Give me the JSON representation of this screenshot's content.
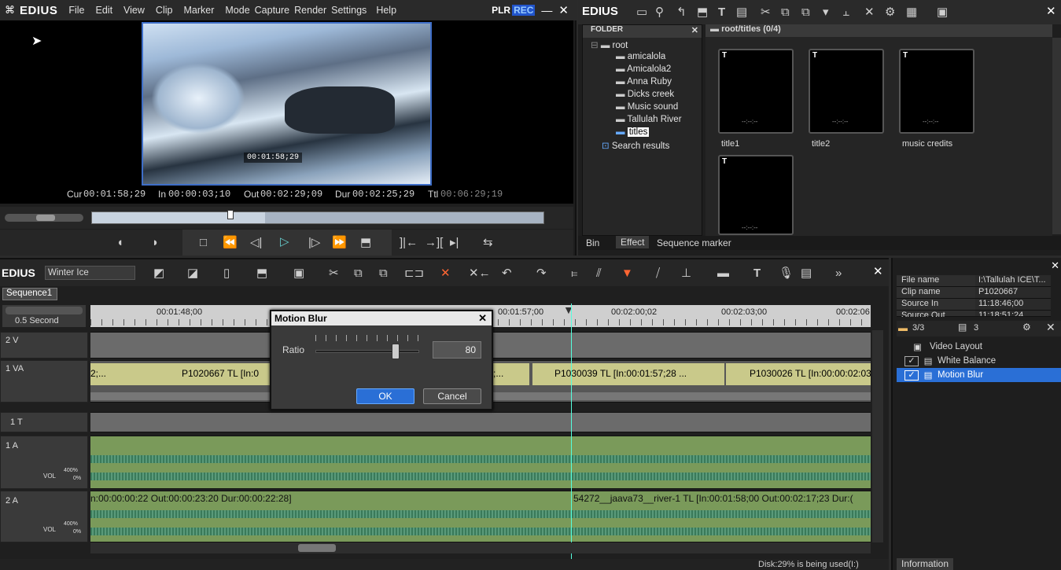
{
  "player": {
    "logo": "EDIUS",
    "menu": [
      "File",
      "Edit",
      "View",
      "Clip",
      "Marker",
      "Mode",
      "Capture",
      "Render",
      "Settings",
      "Help"
    ],
    "mode_plr": "PLR",
    "mode_rec": "REC",
    "overlay_tc": "00:01:58;29",
    "cur_label": "Cur",
    "cur": "00:01:58;29",
    "in_label": "In",
    "in": "00:00:03;10",
    "out_label": "Out",
    "out": "00:02:29;09",
    "dur_label": "Dur",
    "dur": "00:02:25;29",
    "ttl_label": "Ttl",
    "ttl": "00:06:29;19"
  },
  "bin": {
    "logo": "EDIUS",
    "folder_header": "FOLDER",
    "path": "root/titles (0/4)",
    "tree": [
      "root",
      "amicalola",
      "Amicalola2",
      "Anna Ruby",
      "Dicks creek",
      "Music sound",
      "Tallulah River",
      "titles",
      "Search results"
    ],
    "thumbs": [
      {
        "name": "title1"
      },
      {
        "name": "title2"
      },
      {
        "name": "music credits"
      },
      {
        "name": ""
      }
    ],
    "tabs": [
      "Bin",
      "Effect",
      "Sequence marker"
    ]
  },
  "timeline": {
    "logo": "EDIUS",
    "project": "Winter Ice",
    "sequence_tab": "Sequence1",
    "scale": "0.5 Second",
    "ruler": [
      "00:01:48;00",
      "00:01:57;00",
      "00:02:00;02",
      "00:02:03;00",
      "00:02:06"
    ],
    "tracks": {
      "v2": "2 V",
      "va1": "1 VA",
      "t1": "1 T",
      "a1": "1 A",
      "a2": "2 A",
      "vol": "VOL",
      "vol_pct": "400%",
      "vol_zero": "0%"
    },
    "clip1": "P1020667  TL [In:0",
    "clip2": "P1030039  TL [In:00:01:57;28 ...",
    "clip3": "P1030026  TL [In:00:00:02:03",
    "clip_left": "2;...",
    "clip_mid": ";...",
    "audio2_left": "n:00:00:00:22 Out:00:00:23:20 Dur:00:00:22:28]",
    "audio2_right": "54272__jaava73__river-1   TL [In:00:01:58;00 Out:00:02:17;23 Dur:("
  },
  "dialog": {
    "title": "Motion Blur",
    "ratio_label": "Ratio",
    "ratio_value": "80",
    "ratio_fraction": 0.8,
    "ok": "OK",
    "cancel": "Cancel"
  },
  "info": {
    "rows": [
      {
        "k": "File name",
        "v": "I:\\Tallulah ICE\\T..."
      },
      {
        "k": "Clip name",
        "v": "P1020667"
      },
      {
        "k": "Source In",
        "v": "11:18:46;00"
      },
      {
        "k": "Source Out",
        "v": "11:18:51;24"
      }
    ],
    "count": "3/3",
    "count2": "3",
    "filters": [
      "Video Layout",
      "White Balance",
      "Motion Blur"
    ],
    "tab": "Information"
  },
  "status": {
    "disk": "Disk:29% is being used(I:)"
  }
}
